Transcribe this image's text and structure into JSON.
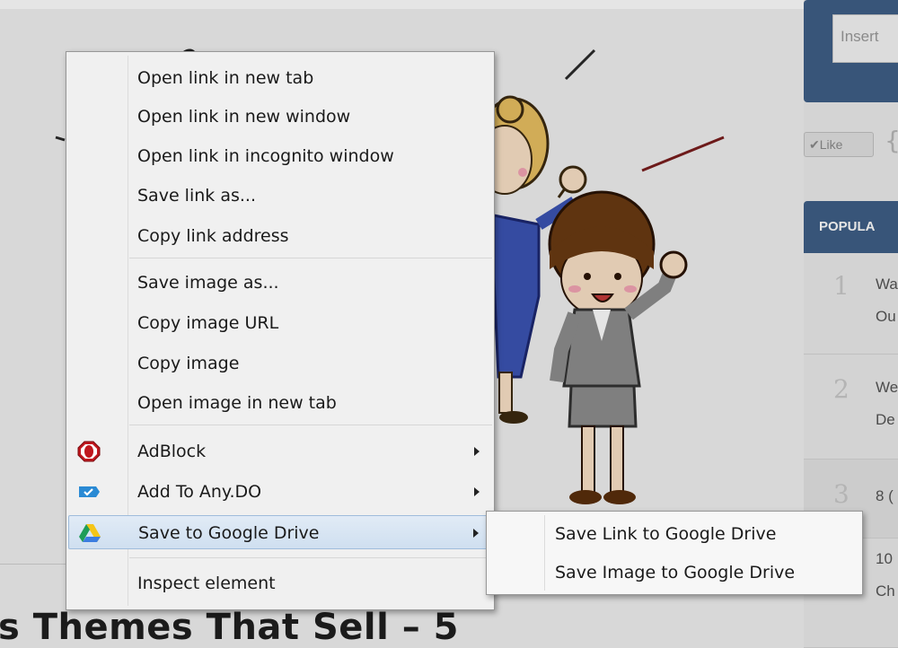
{
  "background": {
    "headline": "s Themes That Sell – 5",
    "sidebar": {
      "search_placeholder": "Insert",
      "like_label": "✔Like",
      "like_bracket": "{",
      "popular_title": "POPULA",
      "items": [
        {
          "num": "1",
          "line1": "Wa",
          "line2": "Ou"
        },
        {
          "num": "2",
          "line1": "We",
          "line2": "De"
        },
        {
          "num": "3",
          "line1": "8 (",
          "line2": ""
        },
        {
          "num": "",
          "line1": "10",
          "line2": "Ch"
        }
      ]
    }
  },
  "context_menu": {
    "items": [
      {
        "label": "Open link in new tab"
      },
      {
        "label": "Open link in new window"
      },
      {
        "label": "Open link in incognito window"
      },
      {
        "label": "Save link as..."
      },
      {
        "label": "Copy link address"
      },
      {
        "label": "Save image as..."
      },
      {
        "label": "Copy image URL"
      },
      {
        "label": "Copy image"
      },
      {
        "label": "Open image in new tab"
      },
      {
        "label": "AdBlock",
        "icon": "adblock-icon",
        "submenu": true
      },
      {
        "label": "Add To Any.DO",
        "icon": "anydo-icon",
        "submenu": true
      },
      {
        "label": "Save to Google Drive",
        "icon": "google-drive-icon",
        "submenu": true,
        "highlighted": true
      },
      {
        "label": "Inspect element"
      }
    ]
  },
  "submenu": {
    "items": [
      {
        "label": "Save Link to Google Drive"
      },
      {
        "label": "Save Image to Google Drive"
      }
    ]
  },
  "colors": {
    "menu_bg": "#f0f0f0",
    "highlight": "#cfdff0",
    "sidebar_accent": "#3f5f87",
    "adblock_red": "#c0181e",
    "anydo_blue": "#2a8ad4"
  }
}
